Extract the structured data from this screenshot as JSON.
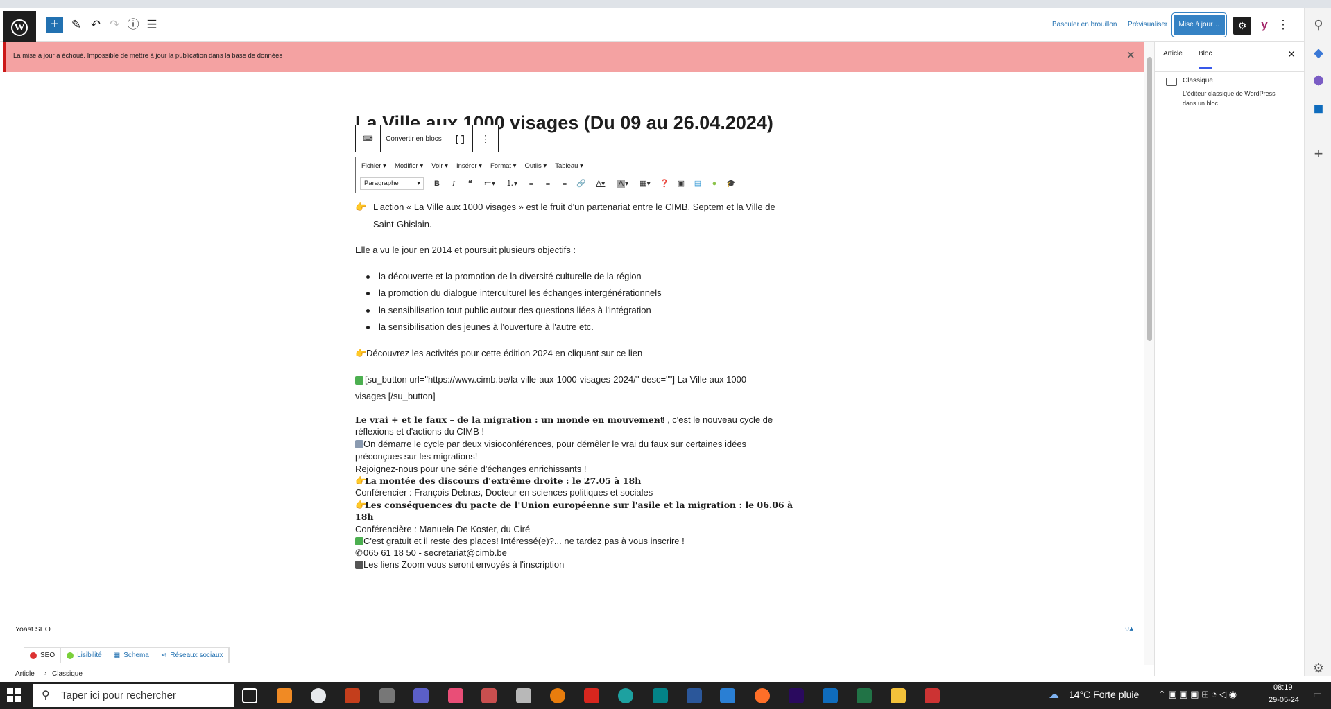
{
  "topbar": {
    "switch_to_draft": "Basculer en brouillon",
    "preview": "Prévisualiser",
    "update": "Mise à jour…"
  },
  "notice": {
    "message": "La mise à jour a échoué. Impossible de mettre à jour la publication dans la base de données"
  },
  "settings_panel": {
    "tabs": [
      "Article",
      "Bloc"
    ],
    "block_name": "Classique",
    "block_desc_line1": "L'éditeur classique de WordPress",
    "block_desc_line2": "dans un bloc."
  },
  "post": {
    "title": "La Ville aux 1000 visages (Du 09 au 26.04.2024)"
  },
  "block_toolbar": {
    "convert_label": "Convertir en blocs"
  },
  "tinymce": {
    "menus": [
      "Fichier",
      "Modifier",
      "Voir",
      "Insérer",
      "Format",
      "Outils",
      "Tableau"
    ],
    "format_select": "Paragraphe"
  },
  "content": {
    "p1_line1": "L'action « La Ville aux 1000 visages » est le fruit d'un partenariat entre le CIMB, Septem et la Ville de",
    "p1_line2": "Saint-Ghislain.",
    "p2": "Elle a vu le jour en 2014 et poursuit plusieurs objectifs :",
    "bullets": [
      "la découverte et la promotion de la diversité culturelle de la région",
      "la promotion du dialogue interculturel les échanges intergénérationnels",
      "la sensibilisation tout public autour des questions liées à l'intégration",
      "la sensibilisation des jeunes à l'ouverture à l'autre etc."
    ],
    "p3": "Découvrez les activités pour cette édition 2024 en cliquant sur ce lien",
    "shortcode_line1": "[su_button url=\"https://www.cimb.be/la-ville-aux-1000-visages-2024/\" desc=\"\"] La Ville aux 1000",
    "shortcode_line2": "visages [/su_button]",
    "cycle_bold": "Le vrai + et le faux – de la migration : un monde en mouvement",
    "cycle_rest": " » ! , c'est le nouveau cycle de",
    "cycle_line2": "réflexions et d'actions du CIMB !",
    "visio_line1": " On démarre le cycle par deux visioconférences, pour démêler le vrai du faux sur certaines idées",
    "visio_line2": "préconçues sur les migrations!",
    "join": "Rejoignez-nous pour une série d'échanges enrichissants !",
    "talk1_bold": "La montée des discours d'extrême droite : le 27.05 à 18h",
    "speaker1": "Conférencier : François Debras, Docteur en sciences politiques et sociales",
    "talk2_bold_line1": "Les conséquences du pacte de l'Union européenne sur l'asile et la migration : le 06.06 à",
    "talk2_bold_line2": "18h",
    "speaker2": "Conférencière : Manuela De Koster, du Ciré",
    "free": " C'est gratuit et il reste des places! Intéressé(e)?... ne tardez pas à vous inscrire !",
    "phone": "065 61 18 50 - secretariat@cimb.be",
    "zoom": " Les liens Zoom vous seront envoyés à l'inscription"
  },
  "yoast": {
    "title": "Yoast SEO",
    "tabs": [
      "SEO",
      "Lisibilité",
      "Schema",
      "Réseaux sociaux"
    ]
  },
  "breadcrumb": {
    "items": [
      "Article",
      "Classique"
    ]
  },
  "taskbar": {
    "search_placeholder": "Taper ici pour rechercher",
    "weather": "14°C  Forte pluie",
    "time": "08:19",
    "date": "29-05-24"
  },
  "colors": {
    "accent": "#2271b1",
    "notice_bg": "#f4a2a2",
    "notice_border": "#cc1818",
    "taskbar": "#202020"
  }
}
